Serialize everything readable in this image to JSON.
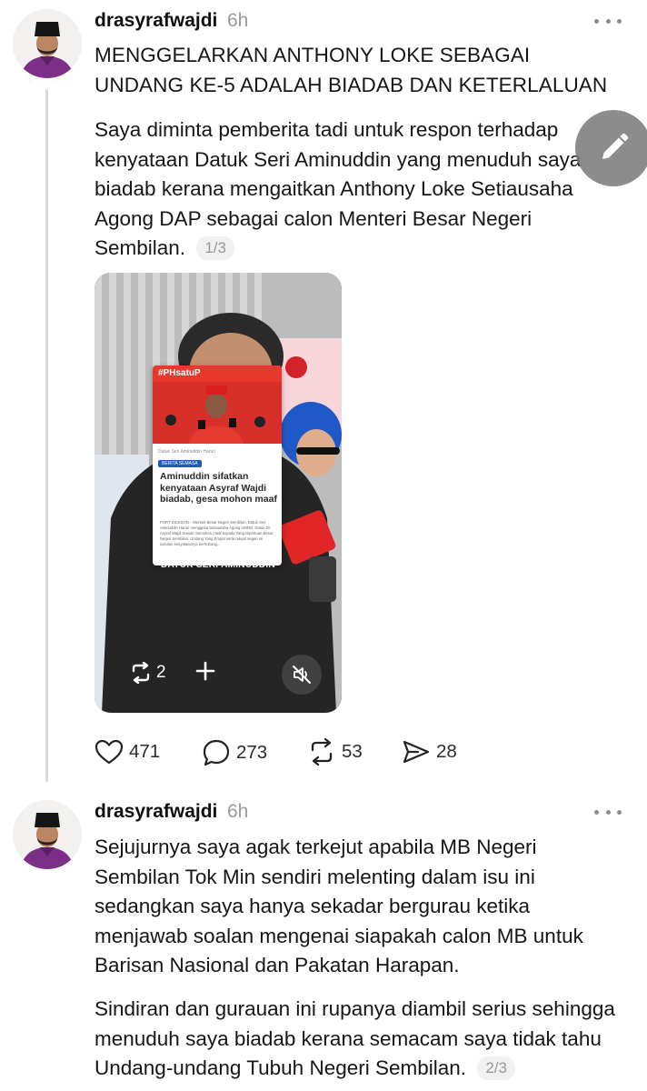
{
  "posts": [
    {
      "username": "drasyrafwajdi",
      "time": "6h",
      "headline": "MENGGELARKAN ANTHONY LOKE SEBAGAI UNDANG KE-5 ADALAH BIADAB DAN KETERLALUAN",
      "body": "Saya diminta pemberita tadi untuk respon terhadap kenyataan Datuk Seri Aminuddin yang menuduh saya biadab kerana mengaitkan Anthony Loke Setiausaha Agong DAP sebagai calon Menteri Besar Negeri Sembilan.",
      "page_indicator": "1/3",
      "video": {
        "article_hashtag": "#PHsatuP",
        "article_meta": "Datuk Seri Aminuddin Harun",
        "article_tag": "BERITA SEMASA",
        "article_title": "Aminuddin sifatkan kenyataan Asyraf Wajdi biadab, gesa mohon maaf",
        "article_body": "PORT DICKSON – Menteri Besar Negeri Sembilan, Datuk Seri Aminuddin Harun menggesa Setiausaha Agung UMNO, Datuk Dr Asyraf Wajdi Dusuki memohon maaf kepada Yang Dipertuan Besar Negeri Sembilan, Undang Yang Empat serta rakyat negeri ini susulan kenyataannya berhubung...",
        "caption": "DATUK SERI AMINUDDIN",
        "repost_count": "2"
      },
      "stats": {
        "likes": "471",
        "replies": "273",
        "reposts": "53",
        "shares": "28"
      }
    },
    {
      "username": "drasyrafwajdi",
      "time": "6h",
      "body_1": "Sejujurnya saya agak terkejut apabila MB Negeri Sembilan Tok Min sendiri melenting dalam isu ini sedangkan saya hanya sekadar bergurau ketika menjawab soalan mengenai siapakah calon MB untuk Barisan Nasional dan Pakatan Harapan.",
      "body_2": "Sindiran dan gurauan ini rupanya diambil serius sehingga menuduh saya biadab kerana semacam saya tidak tahu Undang-undang Tubuh Negeri Sembilan.",
      "page_indicator": "2/3"
    }
  ],
  "icons": {
    "more": "more-horizontal-icon",
    "compose": "pencil-icon",
    "like": "heart-icon",
    "reply": "speech-bubble-icon",
    "repost": "repost-arrows-icon",
    "share": "paper-plane-icon",
    "mute": "speaker-muted-icon",
    "add": "plus-icon"
  },
  "colors": {
    "text": "#161616",
    "muted": "#9a9a9a",
    "thread_line": "#d9d9d9",
    "fab": "#787878",
    "article_red": "#e8372c"
  }
}
